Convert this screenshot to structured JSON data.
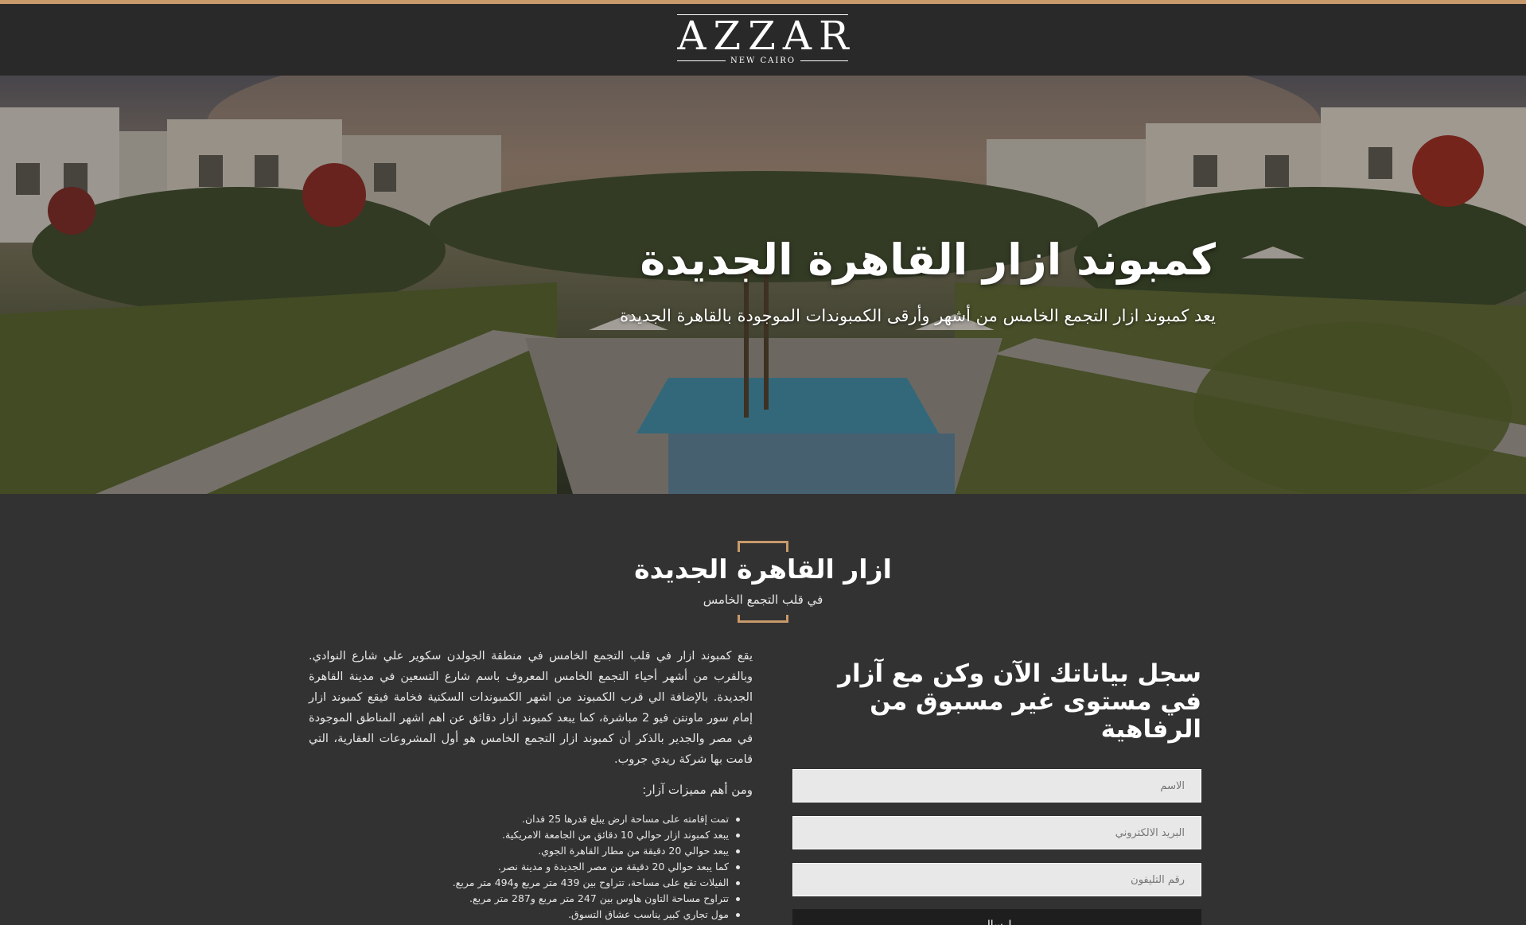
{
  "header": {
    "logo_main": "AZZAR",
    "logo_sub": "NEW CAIRO"
  },
  "hero": {
    "title": "كمبوند ازار القاهرة الجديدة",
    "subtitle": "يعد كمبوند ازار التجمع الخامس من أشهر وأرقى الكمبوندات الموجودة بالقاهرة الجديدة"
  },
  "section": {
    "title": "ازار القاهرة الجديدة",
    "subtitle": "في قلب التجمع الخامس"
  },
  "about": {
    "paragraph": "يقع كمبوند ازار في قلب التجمع الخامس في منطقة الجولدن سكوير علي شارع النوادي. وبالقرب من أشهر أحياء التجمع الخامس المعروف باسم شارع التسعين في مدينة القاهرة الجديدة. بالإضافة الي قرب الكمبوند من اشهر الكمبوندات السكنية فخامة فيقع كمبوند ازار إمام سور ماونتن فيو 2 مباشرة، كما يبعد كمبوند ازار دقائق عن اهم اشهر المناطق الموجودة في مصر والجدير بالذكر أن كمبوند ازار التجمع الخامس هو أول المشروعات العقارية، التي قامت بها شركة ريدي جروب.",
    "features_title": "ومن أهم مميزات آزار:",
    "features": [
      "تمت إقامته على مساحة ارض يبلغ قدرها 25 فدان.",
      "يبعد كمبوند ازار حوالي 10 دقائق من الجامعة الامريكية.",
      "يبعد حوالي 20 دقيقة من مطار القاهرة الجوي.",
      "كما يبعد حوالي 20 دقيقة من مصر الجديدة و مدينة نصر.",
      "الفيلات تقع على مساحة، تتراوح بين 439 متر مربع و494 متر مربع.",
      "تتراوح مساحة التاون هاوس بين 247 متر مربع و287 متر مربع.",
      "مول تجاري كبير يناسب عشاق التسوق."
    ]
  },
  "form": {
    "title": "سجل بياناتك الآن وكن مع آزار في مستوى غير مسبوق من الرفاهية",
    "name_placeholder": "الاسم",
    "email_placeholder": "البريد الالكتروني",
    "phone_placeholder": "رقم التليفون",
    "submit_label": "إرسال"
  },
  "colors": {
    "accent": "#c89a6b",
    "background": "#333232",
    "header": "#2a2929"
  }
}
